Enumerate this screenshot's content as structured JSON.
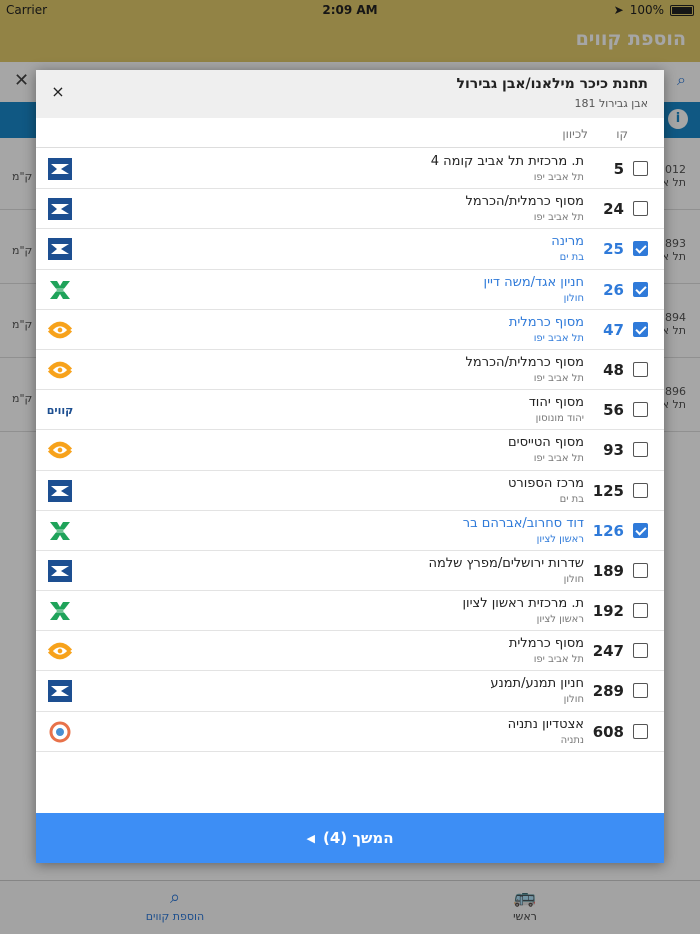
{
  "status_bar": {
    "carrier": "Carrier",
    "time": "2:09 AM",
    "battery": "100%"
  },
  "app": {
    "title": "הוספת קווים"
  },
  "background_rows": [
    {
      "num": "012",
      "sub": "תל א",
      "km": "ק\"מ"
    },
    {
      "num": "893",
      "sub": "תל א",
      "km": "ק\"מ"
    },
    {
      "num": "894",
      "sub": "תל א",
      "km": "ק\"מ"
    },
    {
      "num": "896",
      "sub": "תל א",
      "km": "ק\"מ"
    }
  ],
  "tabbar": {
    "add_lines": "הוספת קווים",
    "main": "ראשי"
  },
  "modal": {
    "station_title": "תחנת כיכר מילאנו/אבן גבירול",
    "station_address": "אבן גבירול 181",
    "close_label": "×",
    "header_line": "קו",
    "header_direction": "לכיוון",
    "continue_label": "המשך (4)",
    "routes": [
      {
        "line": "5",
        "dest": "ת. מרכזית תל אביב קומה 4",
        "city": "תל אביב יפו",
        "checked": false,
        "operator": "dan"
      },
      {
        "line": "24",
        "dest": "מסוף כרמלית/הכרמל",
        "city": "תל אביב יפו",
        "checked": false,
        "operator": "dan"
      },
      {
        "line": "25",
        "dest": "מרינה",
        "city": "בת ים",
        "checked": true,
        "operator": "dan"
      },
      {
        "line": "26",
        "dest": "חניון אגד/משה דיין",
        "city": "חולון",
        "checked": true,
        "operator": "egged"
      },
      {
        "line": "47",
        "dest": "מסוף כרמלית",
        "city": "תל אביב יפו",
        "checked": true,
        "operator": "metropoline"
      },
      {
        "line": "48",
        "dest": "מסוף כרמלית/הכרמל",
        "city": "תל אביב יפו",
        "checked": false,
        "operator": "metropoline"
      },
      {
        "line": "56",
        "dest": "מסוף יהוד",
        "city": "יהוד מונוסון",
        "checked": false,
        "operator": "kavim"
      },
      {
        "line": "93",
        "dest": "מסוף הטייסים",
        "city": "תל אביב יפו",
        "checked": false,
        "operator": "metropoline"
      },
      {
        "line": "125",
        "dest": "מרכז הספורט",
        "city": "בת ים",
        "checked": false,
        "operator": "dan"
      },
      {
        "line": "126",
        "dest": "דוד סחרוב/אברהם בר",
        "city": "ראשון לציון",
        "checked": true,
        "operator": "egged"
      },
      {
        "line": "189",
        "dest": "שדרות ירושלים/מפרץ שלמה",
        "city": "חולון",
        "checked": false,
        "operator": "dan"
      },
      {
        "line": "192",
        "dest": "ת. מרכזית ראשון לציון",
        "city": "ראשון לציון",
        "checked": false,
        "operator": "egged"
      },
      {
        "line": "247",
        "dest": "מסוף כרמלית",
        "city": "תל אביב יפו",
        "checked": false,
        "operator": "metropoline"
      },
      {
        "line": "289",
        "dest": "חניון תמנע/תמנע",
        "city": "חולון",
        "checked": false,
        "operator": "dan"
      },
      {
        "line": "608",
        "dest": "אצטדיון נתניה",
        "city": "נתניה",
        "checked": false,
        "operator": "nateev"
      }
    ]
  },
  "colors": {
    "accent": "#2f7ad9",
    "header_gold": "#e0c96a",
    "continue_blue": "#3d8ef5",
    "info_blue": "#1a88c9"
  },
  "kavim_logo_text": "קווים"
}
